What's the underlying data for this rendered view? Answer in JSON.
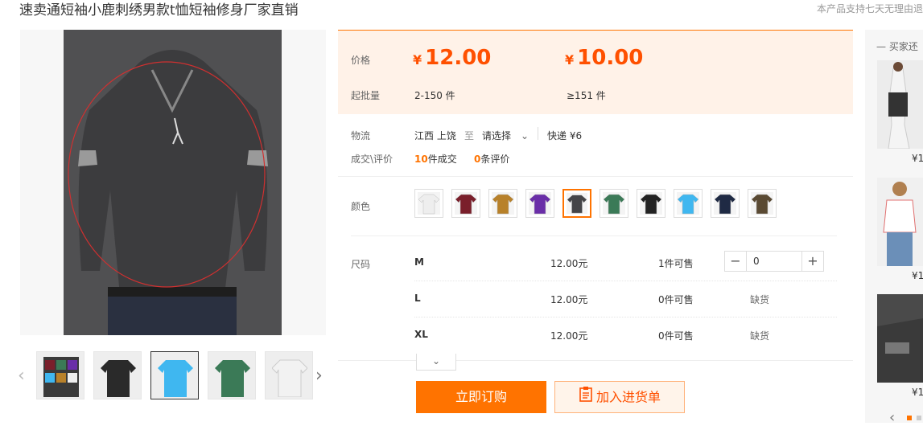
{
  "product": {
    "title": "速卖通短袖小鹿刺绣男款t恤短袖修身厂家直销",
    "notice": "本产品支持七天无理由退"
  },
  "price": {
    "label": "价格",
    "tiers": [
      {
        "price": "12.00",
        "range": "2-150 件"
      },
      {
        "price": "10.00",
        "range": "≥151 件"
      }
    ],
    "currency": "¥",
    "batch_label": "起批量"
  },
  "logistics": {
    "label": "物流",
    "origin": "江西 上饶",
    "to": "至",
    "destination": "请选择",
    "shipping": "快递 ¥6"
  },
  "deals": {
    "label": "成交\\评价",
    "sold_count": "10",
    "sold_text": "件成交",
    "review_count": "0",
    "review_text": "条评价"
  },
  "color": {
    "label": "颜色",
    "swatches": [
      "#eeeeee",
      "#7a1f2b",
      "#b8812a",
      "#6a2ea8",
      "#454548",
      "#3b7a57",
      "#222222",
      "#3fb7f0",
      "#1f2a44",
      "#5a4a33"
    ],
    "selected_index": 4
  },
  "size": {
    "label": "尺码",
    "rows": [
      {
        "name": "M",
        "price": "12.00元",
        "stock": "1件可售",
        "qty": "0",
        "status": ""
      },
      {
        "name": "L",
        "price": "12.00元",
        "stock": "0件可售",
        "qty": "",
        "status": "缺货"
      },
      {
        "name": "XL",
        "price": "12.00元",
        "stock": "0件可售",
        "qty": "",
        "status": "缺货"
      }
    ]
  },
  "actions": {
    "order": "立即订购",
    "cart": "加入进货单"
  },
  "sidebar": {
    "title": "买家还",
    "prices": [
      "¥1",
      "¥1",
      "¥1"
    ]
  }
}
